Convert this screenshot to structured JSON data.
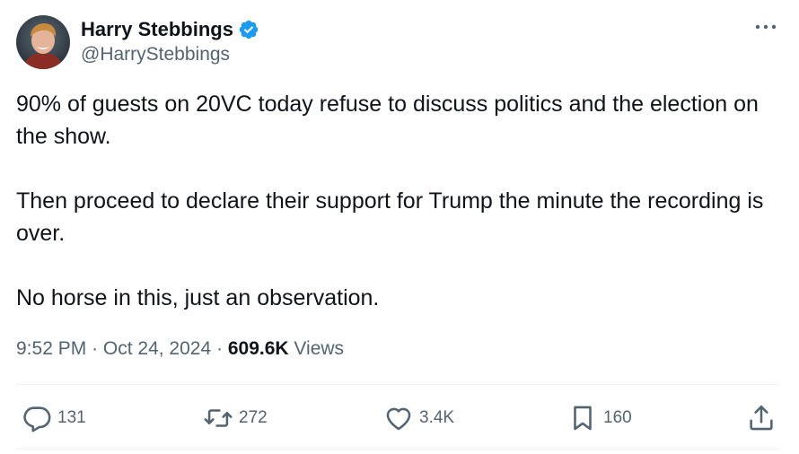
{
  "author": {
    "display_name": "Harry Stebbings",
    "handle": "@HarryStebbings",
    "verified": true,
    "verified_color": "#1d9bf0"
  },
  "tweet": {
    "paragraphs": [
      "90% of guests on 20VC today refuse to discuss politics and the election on the show.",
      "Then proceed to declare their support for Trump the minute the recording is over.",
      "No horse in this, just an observation."
    ],
    "time": "9:52 PM",
    "date": "Oct 24, 2024",
    "separator": "·",
    "views_count": "609.6K",
    "views_label": "Views"
  },
  "actions": {
    "replies": "131",
    "retweets": "272",
    "likes": "3.4K",
    "bookmarks": "160"
  },
  "icons": {
    "more": "more-horizontal-icon",
    "reply": "reply-icon",
    "retweet": "retweet-icon",
    "like": "heart-icon",
    "bookmark": "bookmark-icon",
    "share": "share-icon"
  },
  "colors": {
    "text_primary": "#0f1419",
    "text_secondary": "#536471",
    "divider": "#eff3f4"
  }
}
